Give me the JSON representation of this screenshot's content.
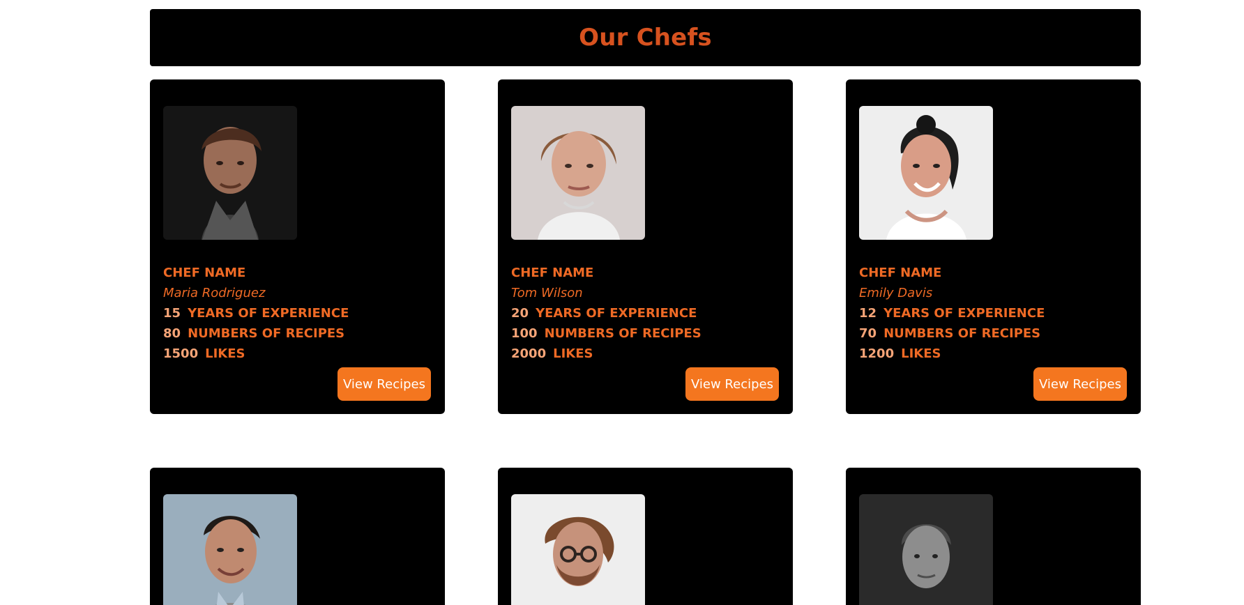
{
  "header": {
    "title": "Our Chefs"
  },
  "chef_cards": [
    {
      "label": "CHEF NAME",
      "name": "Maria Rodriguez",
      "years": "15",
      "years_label": "YEARS OF EXPERIENCE",
      "recipes": "80",
      "recipes_label": "NUMBERS OF RECIPES",
      "likes": "1500",
      "likes_label": "LIKES",
      "button_label": "View Recipes"
    },
    {
      "label": "CHEF NAME",
      "name": "Tom Wilson",
      "years": "20",
      "years_label": "YEARS OF EXPERIENCE",
      "recipes": "100",
      "recipes_label": "NUMBERS OF RECIPES",
      "likes": "2000",
      "likes_label": "LIKES",
      "button_label": "View Recipes"
    },
    {
      "label": "CHEF NAME",
      "name": "Emily Davis",
      "years": "12",
      "years_label": "YEARS OF EXPERIENCE",
      "recipes": "70",
      "recipes_label": "NUMBERS OF RECIPES",
      "likes": "1200",
      "likes_label": "LIKES",
      "button_label": "View Recipes"
    }
  ],
  "colors": {
    "accent": "#ef6a25",
    "title": "#d7521f",
    "button": "#f4761f",
    "card_background": "#000000",
    "page_background": "#ffffff"
  }
}
